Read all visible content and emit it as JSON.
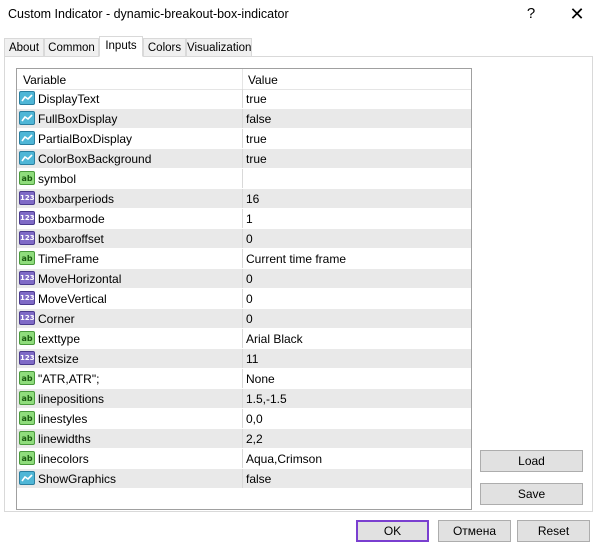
{
  "window": {
    "title": "Custom Indicator - dynamic-breakout-box-indicator",
    "help_glyph": "?",
    "close_glyph": "✕"
  },
  "tabs": [
    {
      "label": "About"
    },
    {
      "label": "Common"
    },
    {
      "label": "Inputs",
      "active": true
    },
    {
      "label": "Colors"
    },
    {
      "label": "Visualization"
    }
  ],
  "grid": {
    "col_variable": "Variable",
    "col_value": "Value",
    "rows": [
      {
        "type": "bool",
        "icon": "boolean-icon",
        "variable": "DisplayText",
        "value": "true"
      },
      {
        "type": "bool",
        "icon": "boolean-icon",
        "variable": "FullBoxDisplay",
        "value": "false"
      },
      {
        "type": "bool",
        "icon": "boolean-icon",
        "variable": "PartialBoxDisplay",
        "value": "true"
      },
      {
        "type": "bool",
        "icon": "boolean-icon",
        "variable": "ColorBoxBackground",
        "value": "true"
      },
      {
        "type": "str",
        "icon": "string-icon",
        "icon_text": "ab",
        "variable": "symbol",
        "value": ""
      },
      {
        "type": "int",
        "icon": "integer-icon",
        "icon_text": "123",
        "variable": "boxbarperiods",
        "value": "16"
      },
      {
        "type": "int",
        "icon": "integer-icon",
        "icon_text": "123",
        "variable": "boxbarmode",
        "value": "1"
      },
      {
        "type": "int",
        "icon": "integer-icon",
        "icon_text": "123",
        "variable": "boxbaroffset",
        "value": "0"
      },
      {
        "type": "str",
        "icon": "string-icon",
        "icon_text": "ab",
        "variable": "TimeFrame",
        "value": "Current time frame"
      },
      {
        "type": "int",
        "icon": "integer-icon",
        "icon_text": "123",
        "variable": "MoveHorizontal",
        "value": "0"
      },
      {
        "type": "int",
        "icon": "integer-icon",
        "icon_text": "123",
        "variable": "MoveVertical",
        "value": "0"
      },
      {
        "type": "int",
        "icon": "integer-icon",
        "icon_text": "123",
        "variable": "Corner",
        "value": "0"
      },
      {
        "type": "str",
        "icon": "string-icon",
        "icon_text": "ab",
        "variable": "texttype",
        "value": "Arial Black"
      },
      {
        "type": "int",
        "icon": "integer-icon",
        "icon_text": "123",
        "variable": "textsize",
        "value": "11"
      },
      {
        "type": "str",
        "icon": "string-icon",
        "icon_text": "ab",
        "variable": "\"ATR,ATR\";",
        "value": "None"
      },
      {
        "type": "str",
        "icon": "string-icon",
        "icon_text": "ab",
        "variable": "linepositions",
        "value": "1.5,-1.5"
      },
      {
        "type": "str",
        "icon": "string-icon",
        "icon_text": "ab",
        "variable": "linestyles",
        "value": "0,0"
      },
      {
        "type": "str",
        "icon": "string-icon",
        "icon_text": "ab",
        "variable": "linewidths",
        "value": "2,2"
      },
      {
        "type": "str",
        "icon": "string-icon",
        "icon_text": "ab",
        "variable": "linecolors",
        "value": "Aqua,Crimson"
      },
      {
        "type": "bool",
        "icon": "boolean-icon",
        "variable": "ShowGraphics",
        "value": "false"
      }
    ]
  },
  "side_buttons": {
    "load": "Load",
    "save": "Save"
  },
  "footer_buttons": {
    "ok": "OK",
    "cancel": "Отмена",
    "reset": "Reset"
  },
  "colors": {
    "accent_border": "#7a3fd0",
    "alt_row": "#e9e9e9"
  }
}
